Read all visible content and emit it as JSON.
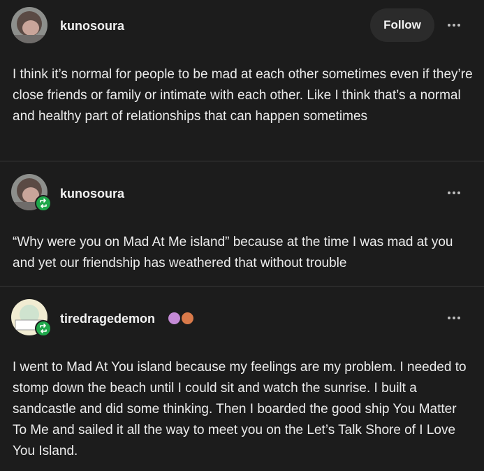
{
  "posts": [
    {
      "username": "kunosoura",
      "follow_label": "Follow",
      "text": "I think it’s normal for people to be mad at each other sometimes even if they’re close friends or family or intimate with each other. Like I think that’s a normal and healthy part of relationships that can happen sometimes"
    },
    {
      "username": "kunosoura",
      "reblogged": true,
      "text": "“Why were you on Mad At Me island” because at the time I was mad at you and yet our friendship has weathered that without trouble"
    },
    {
      "username": "tiredragedemon",
      "reblogged": true,
      "badges": [
        "purple-flower-badge",
        "orange-paw-badge"
      ],
      "text": "I went to Mad At You island because my feelings are my problem. I needed to stomp down the beach until I could sit and watch the sunrise. I built a sandcastle and did some thinking. Then I boarded the good ship You Matter To Me and sailed it all the way to meet you on the Let’s Talk Shore of I Love You Island."
    }
  ],
  "colors": {
    "background": "#1c1c1c",
    "text": "#ececec",
    "reblog_badge": "#1fa74b",
    "follow_button": "#2b2b2b",
    "divider": "#383838"
  }
}
